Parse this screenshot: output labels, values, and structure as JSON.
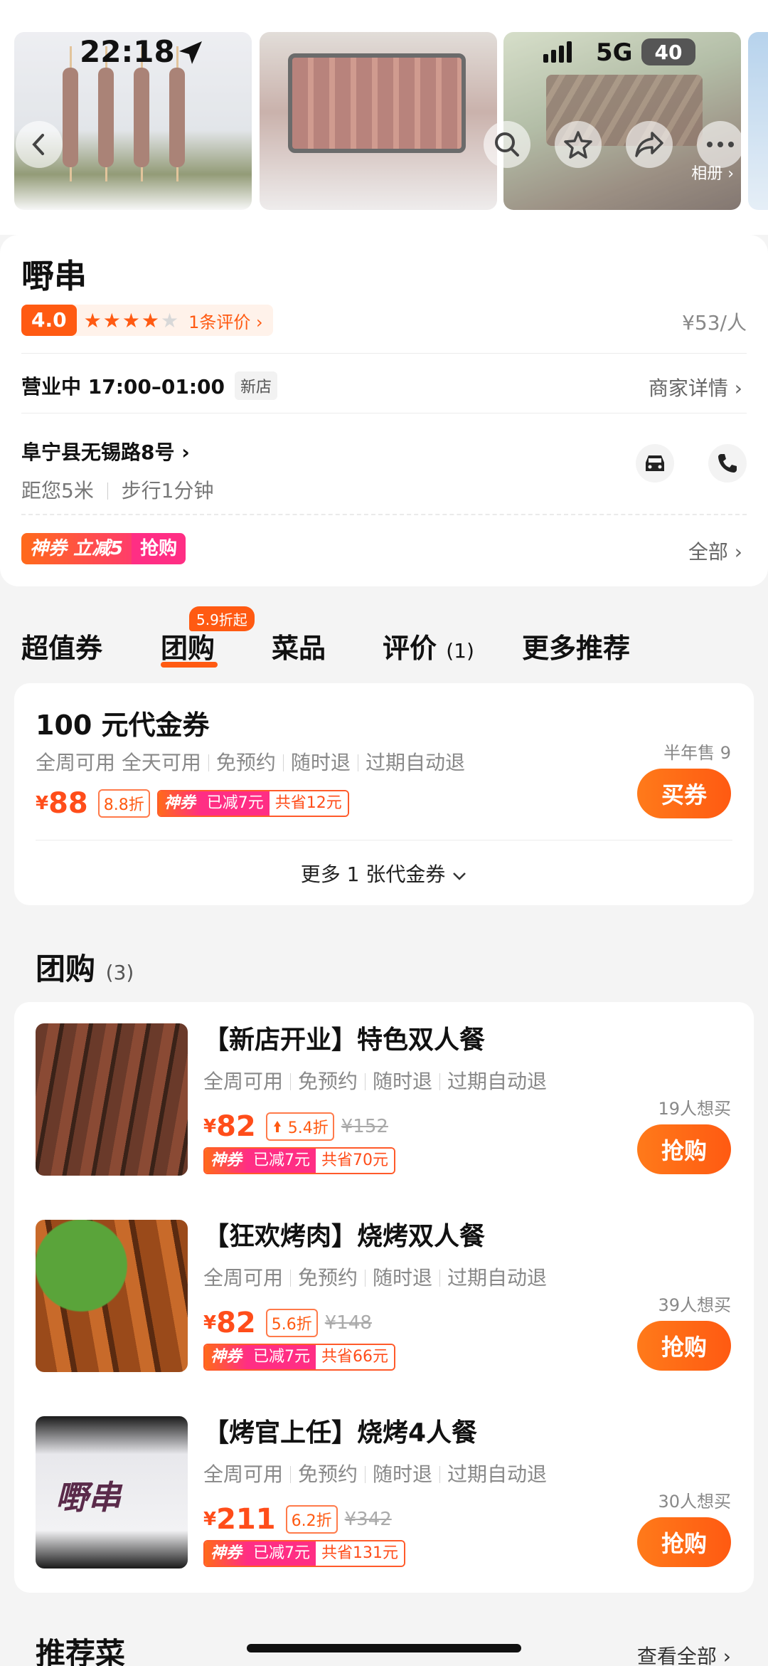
{
  "status_bar": {
    "time": "22:18",
    "network": "5G",
    "battery": "40"
  },
  "gallery": {
    "album_label": "相册 ›"
  },
  "shop": {
    "name": "嘢串",
    "rating": "4.0",
    "stars_filled": 4,
    "reviews_label": "1条评价 ›",
    "price_per_person": "¥53/人",
    "hours": "营业中 17:00–01:00",
    "new_tag": "新店",
    "merchant_details": "商家详情 ›",
    "address": "阜宁县无锡路8号 ›",
    "distance": "距您5米",
    "walk": "步行1分钟",
    "coupon_label": "神券 立减5",
    "coupon_action": "抢购",
    "all_label": "全部 ›"
  },
  "tabs": [
    {
      "label": "超值券"
    },
    {
      "label": "团购",
      "badge": "5.9折起"
    },
    {
      "label": "菜品"
    },
    {
      "label": "评价",
      "count": "(1)"
    },
    {
      "label": "更多推荐"
    }
  ],
  "voucher": {
    "title": "100 元代金券",
    "tags": [
      "全周可用 全天可用",
      "免预约",
      "随时退",
      "过期自动退"
    ],
    "currency": "¥",
    "price": "88",
    "discount": "8.8折",
    "shen_label": "神券",
    "shen_reduced": "已减7元",
    "shen_saved": "共省12元",
    "sold": "半年售 9",
    "buy_label": "买券",
    "more_label": "更多 1 张代金券"
  },
  "group": {
    "title": "团购",
    "count": "(3)",
    "items": [
      {
        "name": "【新店开业】特色双人餐",
        "tags": [
          "全周可用",
          "免预约",
          "随时退",
          "过期自动退"
        ],
        "currency": "¥",
        "price": "82",
        "discount": "5.4折",
        "original": "¥152",
        "shen_label": "神券",
        "shen_reduced": "已减7元",
        "shen_saved": "共省70元",
        "wants": "19人想买",
        "buy_label": "抢购"
      },
      {
        "name": "【狂欢烤肉】烧烤双人餐",
        "tags": [
          "全周可用",
          "免预约",
          "随时退",
          "过期自动退"
        ],
        "currency": "¥",
        "price": "82",
        "discount": "5.6折",
        "original": "¥148",
        "shen_label": "神券",
        "shen_reduced": "已减7元",
        "shen_saved": "共省66元",
        "wants": "39人想买",
        "buy_label": "抢购"
      },
      {
        "name": "【烤官上任】烧烤4人餐",
        "tags": [
          "全周可用",
          "免预约",
          "随时退",
          "过期自动退"
        ],
        "currency": "¥",
        "price": "211",
        "discount": "6.2折",
        "original": "¥342",
        "shen_label": "神券",
        "shen_reduced": "已减7元",
        "shen_saved": "共省131元",
        "wants": "30人想买",
        "buy_label": "抢购",
        "logo_text": "嘢串"
      }
    ]
  },
  "recommended": {
    "title": "推荐菜",
    "view_all": "查看全部 ›"
  },
  "colors": {
    "accent": "#ff5a12",
    "pink": "#ff2e84"
  }
}
